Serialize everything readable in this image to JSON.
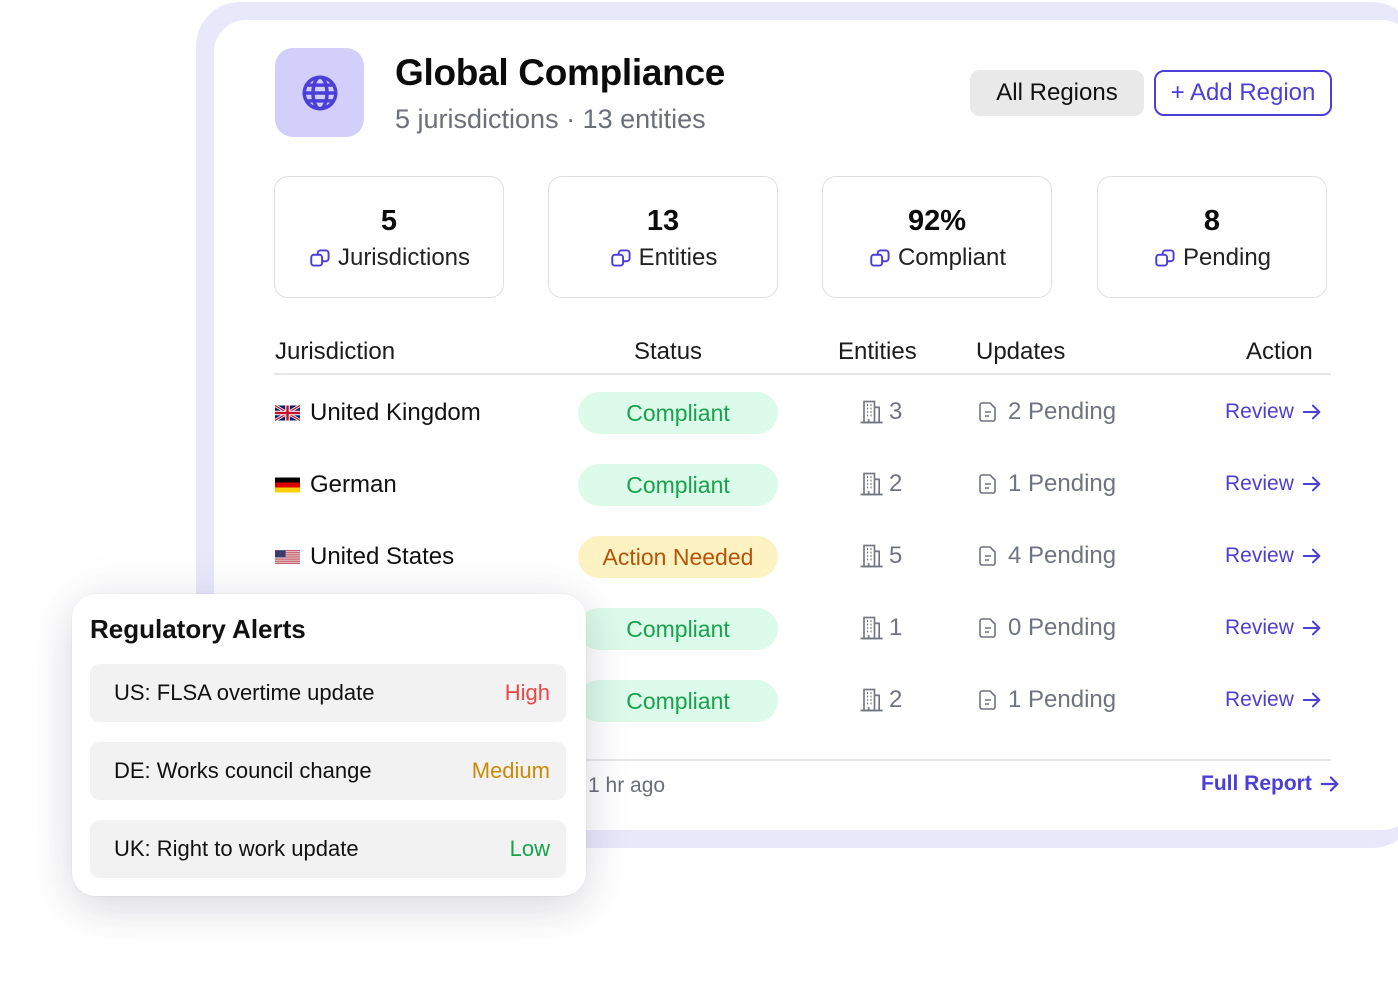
{
  "header": {
    "title": "Global Compliance",
    "subtitle": "5 jurisdictions · 13 entities",
    "logo_icon": "globe-icon",
    "all_regions_label": "All Regions",
    "add_region_label": "+ Add Region"
  },
  "stats": [
    {
      "value": "5",
      "label": "Jurisdictions",
      "icon": "link-squares-icon"
    },
    {
      "value": "13",
      "label": "Entities",
      "icon": "link-squares-icon"
    },
    {
      "value": "92%",
      "label": "Compliant",
      "icon": "link-squares-icon"
    },
    {
      "value": "8",
      "label": "Pending",
      "icon": "link-squares-icon"
    }
  ],
  "table": {
    "headers": {
      "jurisdiction": "Jurisdiction",
      "status": "Status",
      "entities": "Entities",
      "updates": "Updates",
      "action": "Action"
    },
    "rows": [
      {
        "flag": "uk-flag",
        "country": "United Kingdom",
        "status": "Compliant",
        "entities": "3",
        "updates": "2 Pending",
        "action": "Review"
      },
      {
        "flag": "germany-flag",
        "country": "German",
        "status": "Compliant",
        "entities": "2",
        "updates": "1 Pending",
        "action": "Review"
      },
      {
        "flag": "us-flag",
        "country": "United States",
        "status": "Action Needed",
        "entities": "5",
        "updates": "4 Pending",
        "action": "Review"
      },
      {
        "flag": "",
        "country": "",
        "status": "Compliant",
        "entities": "1",
        "updates": "0 Pending",
        "action": "Review"
      },
      {
        "flag": "",
        "country": "",
        "status": "Compliant",
        "entities": "2",
        "updates": "1 Pending",
        "action": "Review"
      }
    ]
  },
  "footer": {
    "updated_text": "ca 1 hr ago",
    "full_report_label": "Full Report"
  },
  "alerts": {
    "title": "Regulatory Alerts",
    "items": [
      {
        "text": "US: FLSA overtime update",
        "level": "High"
      },
      {
        "text": "DE: Works council change",
        "level": "Medium"
      },
      {
        "text": "UK: Right to work update",
        "level": "Low"
      }
    ]
  },
  "colors": {
    "accent": "#4b3fd8",
    "compliant_text": "#15a34a",
    "compliant_bg": "#dcfbea",
    "warn_text": "#b45309",
    "warn_bg": "#fdf3c2",
    "high": "#ef4444",
    "medium": "#ca8a04",
    "low": "#16a34a"
  }
}
